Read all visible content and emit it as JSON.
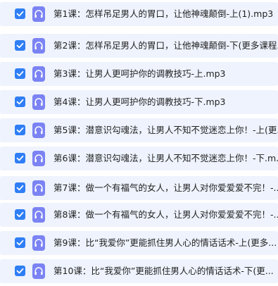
{
  "accent_color": "#2f7ef5",
  "audio_icon_color": "#7b83f4",
  "row_background": "#eef3fd",
  "file_icon": "headphones-audio-file-icon",
  "checkbox_icon": "checkmark-icon",
  "files": [
    {
      "name": "第1课：怎样吊足男人的胃口，让他神魂颠倒-上(1).mp3",
      "checked": true
    },
    {
      "name": "第2课：怎样吊足男人的胃口，让他神魂颠倒-下(更多课程...",
      "checked": true
    },
    {
      "name": "第3课：让男人更呵护你的调教技巧-上.mp3",
      "checked": true
    },
    {
      "name": "第4课：让男人更呵护你的调教技巧-下.mp3",
      "checked": true
    },
    {
      "name": "第5课：潜意识勾魂法，让男人不知不觉迷恋上你！-上(更...",
      "checked": true
    },
    {
      "name": "第6课：潜意识勾魂法，让男人不知不觉迷恋上你！-下.m...",
      "checked": true
    },
    {
      "name": "第7课：做一个有福气的女人，让男人对你爱爱爱不完！-...",
      "checked": true
    },
    {
      "name": "第8课：做一个有福气的女人，让男人对你爱爱爱不完！-...",
      "checked": true
    },
    {
      "name": "第9课：比“我爱你”更能抓住男人心的情话话术-上(更多...",
      "checked": true
    },
    {
      "name": "第10课：比“我爱你”更能抓住男人心的情话话术-下(更...",
      "checked": true
    }
  ]
}
